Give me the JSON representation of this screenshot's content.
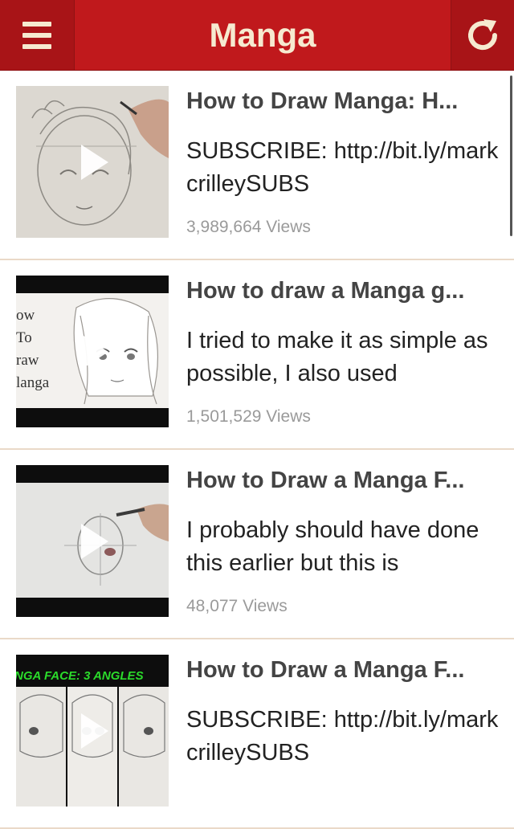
{
  "header": {
    "title": "Manga",
    "menu_icon": "hamburger-menu-icon",
    "refresh_icon": "refresh-icon",
    "colors": {
      "bar": "#c0191c",
      "text": "#f6ead0"
    }
  },
  "videos": [
    {
      "title": "How to Draw Manga: H...",
      "description": "SUBSCRIBE: http://bit.ly/markcrilleySUBS",
      "views": "3,989,664 Views"
    },
    {
      "title": "How to draw a Manga g...",
      "description": "I tried to make it as simple as possible, I also used",
      "views": "1,501,529 Views",
      "thumb_text": [
        "ow",
        "To",
        "raw",
        "langa"
      ]
    },
    {
      "title": "How to Draw a Manga F...",
      "description": "I probably should have done this earlier but this is",
      "views": "48,077 Views"
    },
    {
      "title": "How to Draw a Manga F...",
      "description": "SUBSCRIBE: http://bit.ly/markcrilleySUBS",
      "views": "",
      "thumb_text": [
        "NGA FACE: 3 ANGLES"
      ]
    }
  ]
}
